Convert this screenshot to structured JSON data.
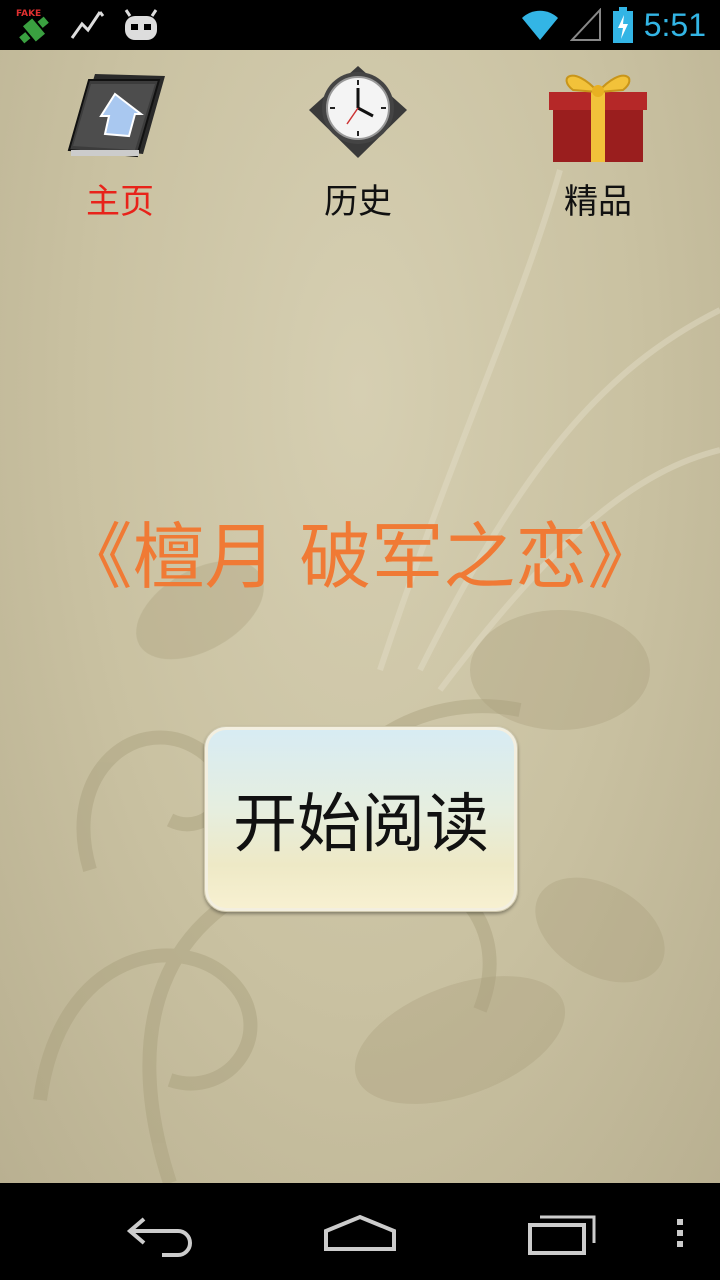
{
  "status_bar": {
    "time": "5:51",
    "left_icons": [
      "fake-gps-icon",
      "activity-graph-icon",
      "android-debug-icon"
    ],
    "right_icons": [
      "wifi-icon",
      "cell-signal-icon",
      "battery-charging-icon"
    ],
    "accent_color": "#33b5e5"
  },
  "tabs": [
    {
      "label": "主页",
      "icon": "home-book-icon",
      "active": true
    },
    {
      "label": "历史",
      "icon": "clock-icon",
      "active": false
    },
    {
      "label": "精品",
      "icon": "gift-box-icon",
      "active": false
    }
  ],
  "book": {
    "title": "《檀月 破军之恋》",
    "title_color": "#f07a35"
  },
  "read_button": {
    "label": "开始阅读"
  },
  "nav_bar": {
    "icons": [
      "back-icon",
      "home-icon",
      "recent-apps-icon",
      "menu-overflow-icon"
    ]
  }
}
